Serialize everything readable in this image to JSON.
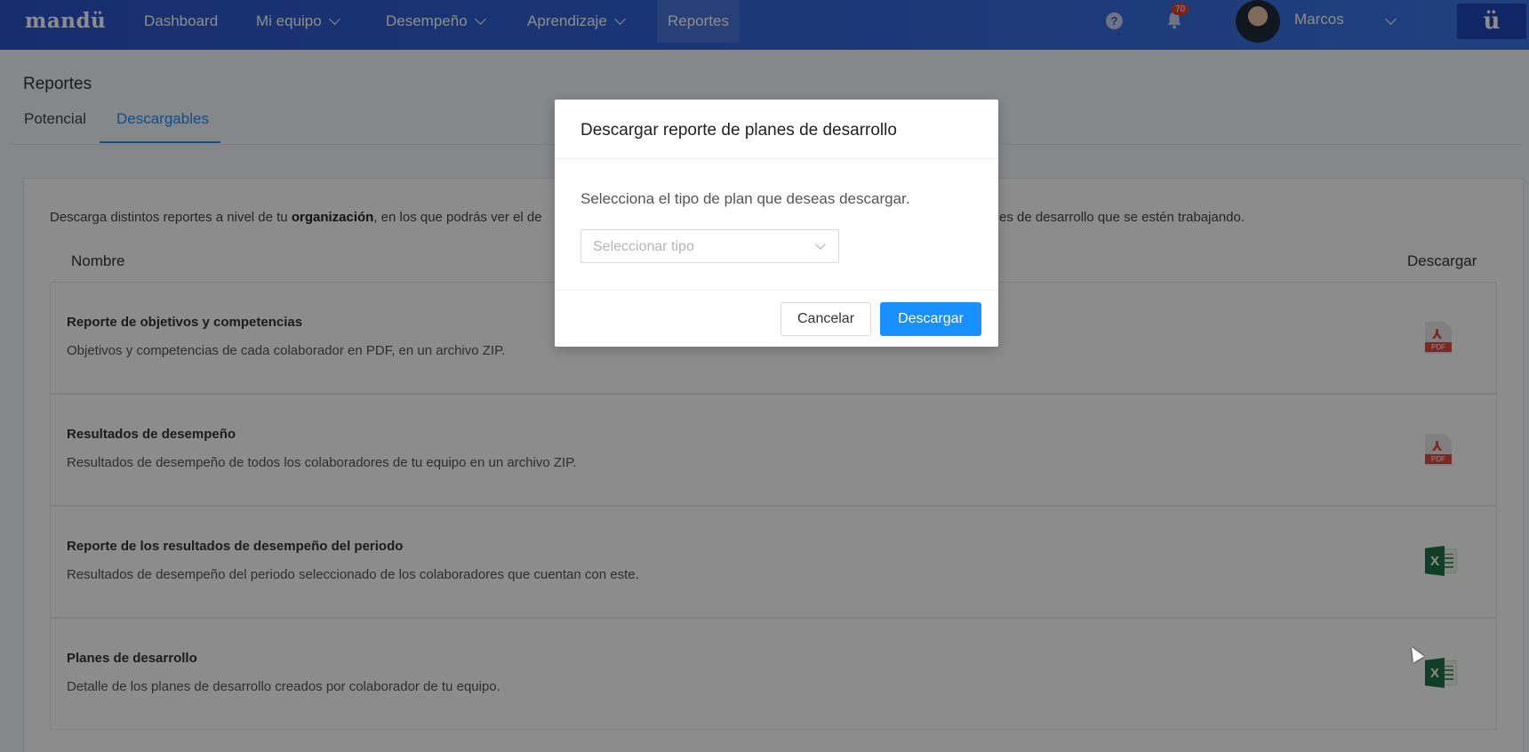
{
  "topnav": {
    "logo": "mandü",
    "items": [
      {
        "label": "Dashboard",
        "has_menu": false
      },
      {
        "label": "Mi equipo",
        "has_menu": true
      },
      {
        "label": "Desempeño",
        "has_menu": true
      },
      {
        "label": "Aprendizaje",
        "has_menu": true
      },
      {
        "label": "Reportes",
        "has_menu": false,
        "active": true
      }
    ],
    "help_icon": "question-icon",
    "notification_icon": "bell-icon",
    "notification_count": "70",
    "user_name": "Marcos",
    "brand_button": "ü"
  },
  "page": {
    "title": "Reportes",
    "tabs": [
      {
        "label": "Potencial",
        "active": false
      },
      {
        "label": "Descargables",
        "active": true
      }
    ]
  },
  "card": {
    "intro_start": "Descarga distintos reportes a nivel de tu ",
    "intro_bold": "organización",
    "intro_middle": ", en los que podrás ver el de",
    "intro_end": "es de desarrollo que se estén trabajando.",
    "columns": {
      "name": "Nombre",
      "download": "Descargar"
    },
    "rows": [
      {
        "title": "Reporte de objetivos y competencias",
        "description": "Objetivos y competencias de cada colaborador en PDF, en un archivo ZIP.",
        "icon": "pdf-icon"
      },
      {
        "title": "Resultados de desempeño",
        "description": "Resultados de desempeño de todos los colaboradores de tu equipo en un archivo ZIP.",
        "icon": "pdf-icon"
      },
      {
        "title": "Reporte de los resultados de desempeño del periodo",
        "description": "Resultados de desempeño del periodo seleccionado de los colaboradores que cuentan con este.",
        "icon": "excel-icon"
      },
      {
        "title": "Planes de desarrollo",
        "description": "Detalle de los planes de desarrollo creados por colaborador de tu equipo.",
        "icon": "excel-icon"
      }
    ]
  },
  "modal": {
    "title": "Descargar reporte de planes de desarrollo",
    "body": "Selecciona el tipo de plan que deseas descargar.",
    "select_placeholder": "Seleccionar tipo",
    "cancel_label": "Cancelar",
    "confirm_label": "Descargar"
  },
  "colors": {
    "nav_gradient_start": "#2b54c9",
    "nav_gradient_end": "#3a75e6",
    "accent": "#1890ff",
    "pdf_red": "#e34b3c",
    "excel_green": "#1e7145"
  }
}
